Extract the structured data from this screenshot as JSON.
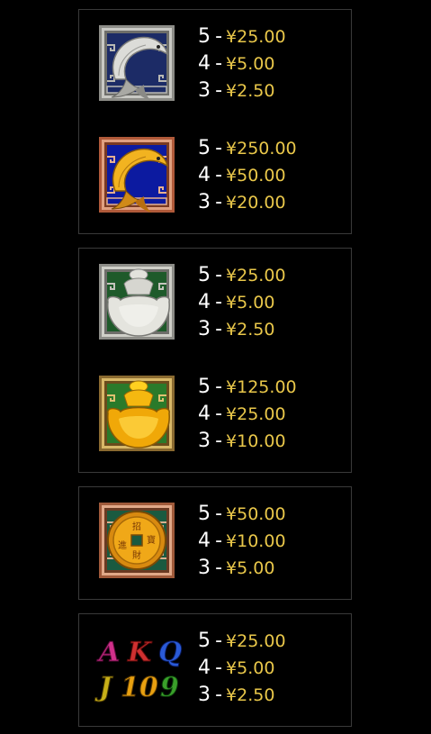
{
  "groups": [
    {
      "entries": [
        {
          "symbol": "silver-carp",
          "pays": [
            {
              "count": "5",
              "amount": "¥25.00"
            },
            {
              "count": "4",
              "amount": "¥5.00"
            },
            {
              "count": "3",
              "amount": "¥2.50"
            }
          ]
        },
        {
          "symbol": "gold-carp",
          "pays": [
            {
              "count": "5",
              "amount": "¥250.00"
            },
            {
              "count": "4",
              "amount": "¥50.00"
            },
            {
              "count": "3",
              "amount": "¥20.00"
            }
          ]
        }
      ]
    },
    {
      "entries": [
        {
          "symbol": "silver-ingot",
          "pays": [
            {
              "count": "5",
              "amount": "¥25.00"
            },
            {
              "count": "4",
              "amount": "¥5.00"
            },
            {
              "count": "3",
              "amount": "¥2.50"
            }
          ]
        },
        {
          "symbol": "gold-ingot",
          "pays": [
            {
              "count": "5",
              "amount": "¥125.00"
            },
            {
              "count": "4",
              "amount": "¥25.00"
            },
            {
              "count": "3",
              "amount": "¥10.00"
            }
          ]
        }
      ]
    },
    {
      "entries": [
        {
          "symbol": "gold-coin",
          "coin_text": [
            "招",
            "進",
            "寶",
            "財"
          ],
          "pays": [
            {
              "count": "5",
              "amount": "¥50.00"
            },
            {
              "count": "4",
              "amount": "¥10.00"
            },
            {
              "count": "3",
              "amount": "¥5.00"
            }
          ]
        }
      ]
    },
    {
      "entries": [
        {
          "symbol": "card-royals",
          "royals": [
            "A",
            "K",
            "Q",
            "J",
            "10",
            "9"
          ],
          "pays": [
            {
              "count": "5",
              "amount": "¥25.00"
            },
            {
              "count": "4",
              "amount": "¥5.00"
            },
            {
              "count": "3",
              "amount": "¥2.50"
            }
          ]
        }
      ]
    }
  ],
  "dash": "-",
  "colors": {
    "amount": "#e9c74a",
    "count": "#ffffff",
    "border": "#3a3a3a"
  }
}
